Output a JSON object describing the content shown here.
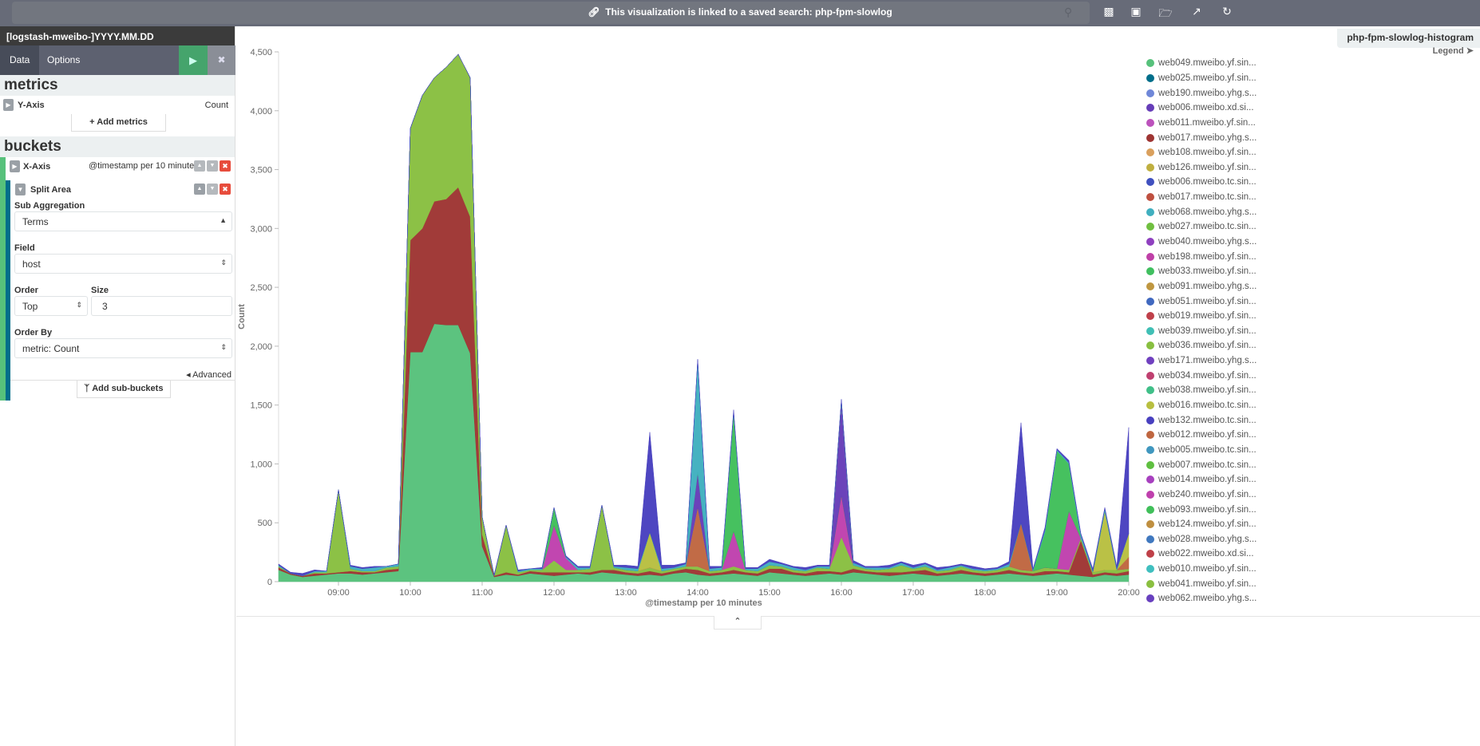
{
  "topbar": {
    "linked_text": "This visualization is linked to a saved search:",
    "saved_search": "php-fpm-slowlog",
    "icons": [
      "link-icon",
      "search-icon",
      "new-visualization-icon",
      "save-icon",
      "open-icon",
      "share-icon",
      "refresh-icon"
    ]
  },
  "sidebar": {
    "index_pattern": "[logstash-mweibo-]YYYY.MM.DD",
    "tabs": [
      {
        "label": "Data",
        "active": true
      },
      {
        "label": "Options",
        "active": false
      }
    ],
    "run_icon": "play-icon",
    "close_icon": "close-icon",
    "metrics": {
      "title": "metrics",
      "yaxis_label": "Y-Axis",
      "yaxis_value": "Count",
      "add_label": "+ Add metrics"
    },
    "buckets": {
      "title": "buckets",
      "xaxis_label": "X-Axis",
      "xaxis_value": "@timestamp per 10 minutes",
      "split": {
        "label": "Split Area",
        "sub_aggregation_label": "Sub Aggregation",
        "sub_aggregation": "Terms",
        "field_label": "Field",
        "field": "host",
        "order_label": "Order",
        "order": "Top",
        "size_label": "Size",
        "size": "3",
        "order_by_label": "Order By",
        "order_by": "metric: Count",
        "advanced": "Advanced"
      },
      "add_label": "Add sub-buckets"
    },
    "colors": {
      "run": "#45a46c",
      "xaxis_bar": "#57c17b",
      "split_bar": "#006e8a",
      "remove": "#e74c3c"
    }
  },
  "chart": {
    "title": "php-fpm-slowlog-histogram",
    "legend_label": "Legend",
    "legend": [
      {
        "name": "web049.mweibo.yf.sin...",
        "color": "#57c17b"
      },
      {
        "name": "web025.mweibo.yf.sin...",
        "color": "#006e8a"
      },
      {
        "name": "web190.mweibo.yhg.s...",
        "color": "#6f87d8"
      },
      {
        "name": "web006.mweibo.xd.si...",
        "color": "#663db8"
      },
      {
        "name": "web011.mweibo.yf.sin...",
        "color": "#bc52bc"
      },
      {
        "name": "web017.mweibo.yhg.s...",
        "color": "#9e3533"
      },
      {
        "name": "web108.mweibo.yf.sin...",
        "color": "#daa05d"
      },
      {
        "name": "web126.mweibo.yf.sin...",
        "color": "#bfaf40"
      },
      {
        "name": "web006.mweibo.tc.sin...",
        "color": "#4050bf"
      },
      {
        "name": "web017.mweibo.tc.sin...",
        "color": "#bf5040"
      },
      {
        "name": "web068.mweibo.yhg.s...",
        "color": "#40afbf"
      },
      {
        "name": "web027.mweibo.tc.sin...",
        "color": "#70bf40"
      },
      {
        "name": "web040.mweibo.yhg.s...",
        "color": "#8f40bf"
      },
      {
        "name": "web198.mweibo.yf.sin...",
        "color": "#bf40a7"
      },
      {
        "name": "web033.mweibo.yf.sin...",
        "color": "#40bf5f"
      },
      {
        "name": "web091.mweibo.yhg.s...",
        "color": "#bf9740"
      },
      {
        "name": "web051.mweibo.yf.sin...",
        "color": "#4068bf"
      },
      {
        "name": "web019.mweibo.yf.sin...",
        "color": "#bf404a"
      },
      {
        "name": "web039.mweibo.yf.sin...",
        "color": "#40bfb5"
      },
      {
        "name": "web036.mweibo.yf.sin...",
        "color": "#88bf40"
      },
      {
        "name": "web171.mweibo.yhg.s...",
        "color": "#7040bf"
      },
      {
        "name": "web034.mweibo.yf.sin...",
        "color": "#bf4070"
      },
      {
        "name": "web038.mweibo.yf.sin...",
        "color": "#40bf88"
      },
      {
        "name": "web016.mweibo.tc.sin...",
        "color": "#b8bf40"
      },
      {
        "name": "web132.mweibo.tc.sin...",
        "color": "#4840bf"
      },
      {
        "name": "web012.mweibo.yf.sin...",
        "color": "#bf6640"
      },
      {
        "name": "web005.mweibo.tc.sin...",
        "color": "#4097bf"
      },
      {
        "name": "web007.mweibo.tc.sin...",
        "color": "#5fbf40"
      },
      {
        "name": "web014.mweibo.yf.sin...",
        "color": "#a740bf"
      },
      {
        "name": "web240.mweibo.yf.sin...",
        "color": "#bf40ad"
      },
      {
        "name": "web093.mweibo.yf.sin...",
        "color": "#40bf5a"
      },
      {
        "name": "web124.mweibo.yf.sin...",
        "color": "#bf8f40"
      },
      {
        "name": "web028.mweibo.yhg.s...",
        "color": "#4078bf"
      },
      {
        "name": "web022.mweibo.xd.si...",
        "color": "#bf4048"
      },
      {
        "name": "web010.mweibo.yf.sin...",
        "color": "#40bfbf"
      },
      {
        "name": "web041.mweibo.yf.sin...",
        "color": "#8abf40"
      },
      {
        "name": "web062.mweibo.yhg.s...",
        "color": "#6840bf"
      }
    ]
  },
  "chart_data": {
    "type": "area",
    "stacked": true,
    "xlabel": "@timestamp per 10 minutes",
    "ylabel": "Count",
    "x_start": "08:10",
    "x_interval_minutes": 10,
    "ylim": [
      0,
      4500
    ],
    "yticks": [
      "0",
      "500",
      "1,000",
      "1,500",
      "2,000",
      "2,500",
      "3,000",
      "3,500",
      "4,000",
      "4,500"
    ],
    "xticks": [
      "09:00",
      "10:00",
      "11:00",
      "12:00",
      "13:00",
      "14:00",
      "15:00",
      "16:00",
      "17:00",
      "18:00",
      "19:00",
      "20:00"
    ],
    "legend_position": "right",
    "series": [
      {
        "name": "web049.mweibo.yf.sin...",
        "color": "#57c17b",
        "values": [
          100,
          60,
          40,
          50,
          60,
          70,
          70,
          60,
          70,
          80,
          90,
          1950,
          1950,
          2190,
          2180,
          2180,
          1940,
          300,
          40,
          60,
          50,
          70,
          60,
          50,
          60,
          70,
          60,
          80,
          70,
          60,
          50,
          60,
          50,
          70,
          80,
          60,
          50,
          60,
          70,
          60,
          50,
          80,
          70,
          60,
          50,
          60,
          70,
          60,
          80,
          70,
          60,
          50,
          60,
          70,
          60,
          50,
          60,
          70,
          60,
          50,
          60,
          70,
          60,
          50,
          60,
          70,
          60,
          50,
          40,
          60,
          50,
          60
        ]
      },
      {
        "name": "web017.mweibo.yhg.s...",
        "color": "#9e3533",
        "values": [
          20,
          10,
          10,
          20,
          10,
          10,
          20,
          20,
          10,
          20,
          20,
          950,
          1050,
          1040,
          1070,
          1170,
          1160,
          100,
          10,
          20,
          10,
          20,
          20,
          30,
          20,
          10,
          20,
          20,
          30,
          20,
          20,
          30,
          20,
          20,
          30,
          40,
          20,
          20,
          30,
          20,
          20,
          30,
          40,
          20,
          20,
          30,
          20,
          20,
          30,
          20,
          20,
          30,
          20,
          20,
          40,
          20,
          20,
          30,
          20,
          20,
          20,
          30,
          20,
          20,
          30,
          20,
          20,
          300,
          20,
          20,
          20,
          30
        ]
      },
      {
        "name": "web036.mweibo.yf.sin...",
        "color": "#88bf40",
        "values": [
          10,
          0,
          0,
          10,
          10,
          700,
          20,
          10,
          10,
          20,
          20,
          950,
          1130,
          1050,
          1120,
          1130,
          1180,
          150,
          0,
          400,
          20,
          10,
          20,
          100,
          20,
          20,
          30,
          550,
          20,
          20,
          20,
          30,
          20,
          20,
          20,
          30,
          20,
          20,
          30,
          20,
          20,
          30,
          20,
          20,
          20,
          30,
          20,
          300,
          30,
          20,
          20,
          30,
          60,
          20,
          30,
          20,
          20,
          30,
          20,
          20,
          20,
          30,
          20,
          20,
          30,
          20,
          20,
          20,
          20,
          20,
          30,
          20
        ]
      },
      {
        "name": "web240.mweibo.yf.sin...",
        "color": "#bf40ad",
        "values": [
          0,
          0,
          0,
          0,
          0,
          0,
          0,
          0,
          0,
          0,
          0,
          0,
          0,
          0,
          0,
          0,
          0,
          0,
          0,
          0,
          0,
          0,
          0,
          300,
          100,
          0,
          0,
          0,
          0,
          0,
          0,
          0,
          0,
          0,
          0,
          0,
          0,
          0,
          300,
          0,
          0,
          0,
          0,
          0,
          0,
          0,
          0,
          350,
          0,
          0,
          0,
          0,
          0,
          0,
          0,
          0,
          0,
          0,
          0,
          0,
          0,
          0,
          0,
          0,
          0,
          0,
          500,
          0,
          0,
          0,
          0,
          0
        ]
      },
      {
        "name": "web012.mweibo.yf.sin...",
        "color": "#bf6640",
        "values": [
          0,
          0,
          0,
          0,
          0,
          0,
          0,
          0,
          0,
          0,
          0,
          0,
          0,
          0,
          0,
          0,
          0,
          0,
          0,
          0,
          0,
          0,
          0,
          0,
          0,
          0,
          0,
          0,
          0,
          0,
          0,
          0,
          0,
          0,
          0,
          500,
          0,
          0,
          0,
          0,
          0,
          0,
          0,
          0,
          0,
          0,
          0,
          0,
          0,
          0,
          0,
          0,
          0,
          0,
          0,
          0,
          0,
          0,
          0,
          0,
          0,
          0,
          400,
          0,
          0,
          0,
          0,
          0,
          0,
          0,
          0,
          100
        ]
      },
      {
        "name": "web016.mweibo.tc.sin...",
        "color": "#b8bf40",
        "values": [
          0,
          0,
          0,
          0,
          0,
          0,
          0,
          0,
          0,
          0,
          0,
          0,
          0,
          0,
          0,
          0,
          0,
          0,
          0,
          0,
          0,
          0,
          0,
          0,
          0,
          0,
          0,
          0,
          0,
          0,
          0,
          300,
          0,
          0,
          0,
          0,
          0,
          0,
          0,
          0,
          0,
          0,
          0,
          0,
          0,
          0,
          0,
          0,
          0,
          0,
          0,
          0,
          0,
          0,
          0,
          0,
          0,
          0,
          0,
          0,
          0,
          0,
          0,
          0,
          0,
          0,
          0,
          0,
          0,
          500,
          0,
          200
        ]
      },
      {
        "name": "web006.mweibo.xd.si...",
        "color": "#663db8",
        "values": [
          0,
          0,
          0,
          0,
          0,
          0,
          0,
          0,
          0,
          0,
          0,
          0,
          0,
          0,
          0,
          0,
          0,
          0,
          0,
          0,
          0,
          0,
          0,
          0,
          0,
          0,
          0,
          0,
          0,
          0,
          0,
          0,
          0,
          0,
          0,
          300,
          0,
          0,
          0,
          0,
          0,
          0,
          0,
          0,
          0,
          0,
          0,
          800,
          0,
          0,
          0,
          0,
          0,
          0,
          0,
          0,
          0,
          0,
          0,
          0,
          0,
          0,
          0,
          0,
          0,
          0,
          0,
          0,
          0,
          0,
          0,
          0
        ]
      },
      {
        "name": "web093.mweibo.yf.sin...",
        "color": "#40bf5a",
        "values": [
          0,
          0,
          0,
          0,
          0,
          0,
          0,
          0,
          0,
          0,
          0,
          0,
          0,
          0,
          0,
          0,
          0,
          0,
          0,
          0,
          0,
          0,
          0,
          150,
          0,
          0,
          0,
          0,
          0,
          0,
          0,
          0,
          0,
          0,
          0,
          0,
          0,
          0,
          1000,
          0,
          0,
          0,
          0,
          0,
          0,
          0,
          0,
          0,
          0,
          0,
          0,
          0,
          0,
          0,
          0,
          0,
          0,
          0,
          0,
          0,
          0,
          0,
          0,
          0,
          300,
          1000,
          400,
          0,
          0,
          0,
          0,
          0
        ]
      },
      {
        "name": "web068.mweibo.yhg.s...",
        "color": "#40afbf",
        "values": [
          10,
          0,
          0,
          10,
          10,
          0,
          20,
          20,
          30,
          10,
          20,
          0,
          0,
          0,
          0,
          0,
          0,
          0,
          0,
          0,
          10,
          10,
          10,
          0,
          10,
          20,
          10,
          0,
          10,
          20,
          20,
          0,
          20,
          10,
          20,
          950,
          20,
          20,
          10,
          10,
          20,
          30,
          20,
          20,
          10,
          10,
          20,
          10,
          20,
          10,
          20,
          10,
          20,
          10,
          20,
          10,
          20,
          10,
          10,
          10,
          10,
          20,
          0,
          10,
          20,
          10,
          10,
          30,
          10,
          20,
          10,
          0
        ]
      },
      {
        "name": "web132.mweibo.tc.sin...",
        "color": "#4840bf",
        "values": [
          10,
          10,
          20,
          10,
          0,
          0,
          10,
          10,
          10,
          0,
          0,
          0,
          0,
          0,
          0,
          0,
          0,
          0,
          10,
          0,
          10,
          0,
          10,
          0,
          10,
          10,
          10,
          0,
          10,
          20,
          20,
          850,
          30,
          20,
          10,
          10,
          20,
          10,
          20,
          10,
          10,
          20,
          10,
          10,
          20,
          10,
          10,
          10,
          20,
          10,
          10,
          20,
          10,
          20,
          10,
          20,
          10,
          10,
          20,
          10,
          10,
          20,
          850,
          10,
          20,
          10,
          20,
          10,
          20,
          10,
          20,
          900
        ]
      }
    ]
  },
  "footer": {
    "collapse_icon": "chevron-up-icon"
  }
}
